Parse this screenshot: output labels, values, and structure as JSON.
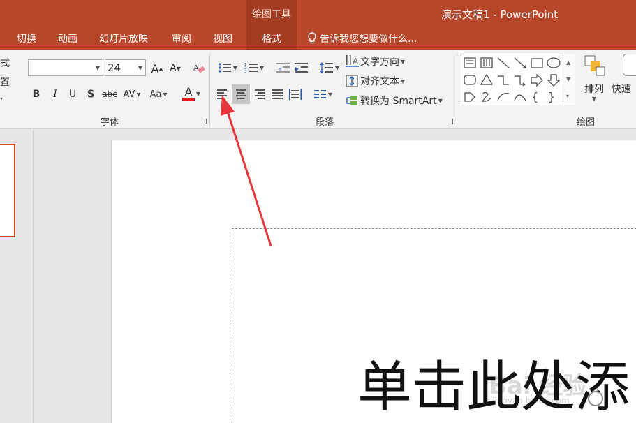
{
  "title_bar": {
    "context_tool": "绘图工具",
    "document_title": "演示文稿1 - PowerPoint"
  },
  "tabs": [
    {
      "label": "切换"
    },
    {
      "label": "动画"
    },
    {
      "label": "幻灯片放映"
    },
    {
      "label": "审阅"
    },
    {
      "label": "视图"
    },
    {
      "label": "格式"
    }
  ],
  "tell_me": {
    "text": "告诉我您想要做什么..."
  },
  "ribbon": {
    "clipped_left": [
      "式",
      "置"
    ],
    "font": {
      "group_label": "字体",
      "font_name": "",
      "font_size": "24",
      "bold": "B",
      "italic": "I",
      "underline": "U",
      "shadow": "S",
      "strikethrough": "abc",
      "spacing": "AV",
      "change_case": "Aa",
      "font_color": "A",
      "font_color_hex": "#e8111d",
      "grow": "A",
      "shrink": "A"
    },
    "paragraph": {
      "group_label": "段落",
      "text_direction": "文字方向",
      "align_text": "对齐文本",
      "smartart": "转换为 SmartArt"
    },
    "drawing": {
      "group_label": "绘图",
      "arrange": "排列",
      "quick_styles": "快速"
    }
  },
  "slide": {
    "title_placeholder": "单击此处添"
  },
  "watermark": {
    "text": "Bai 经验",
    "sub": "jingyan.baidu.com"
  },
  "annotation": {
    "color": "#e8353a"
  }
}
